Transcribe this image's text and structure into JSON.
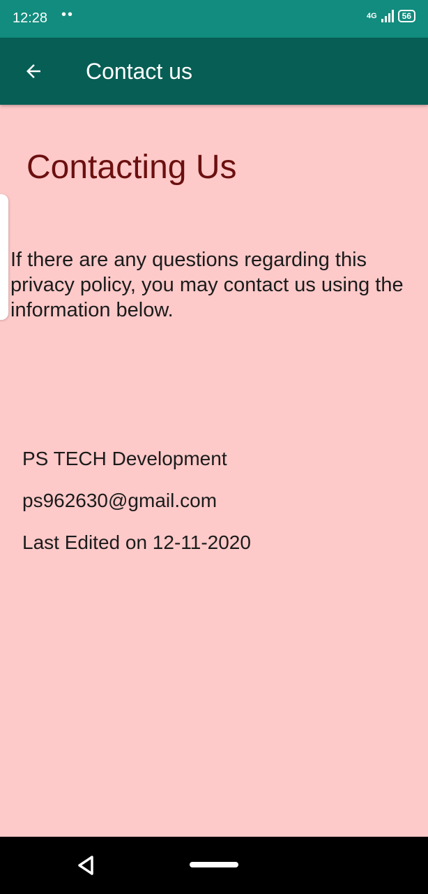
{
  "status_bar": {
    "time": "12:28",
    "notification_dots": "••",
    "network": "4G",
    "battery": "56"
  },
  "app_bar": {
    "back_icon": "arrow-left-icon",
    "title": "Contact us"
  },
  "content": {
    "heading": "Contacting Us",
    "intro_lines": [
      "If there are any questions regarding this",
      "privacy policy, you may contact us using the",
      "information below."
    ],
    "company": "PS TECH Development",
    "email": "ps962630@gmail.com",
    "last_edited": "Last Edited on 12-11-2020"
  },
  "nav_bar": {
    "back_icon": "triangle-back-icon",
    "home_icon": "home-pill-icon"
  },
  "colors": {
    "status_bar": "#128c7e",
    "app_bar": "#075e54",
    "background": "#fec9c9",
    "heading": "#6b0f0f"
  }
}
